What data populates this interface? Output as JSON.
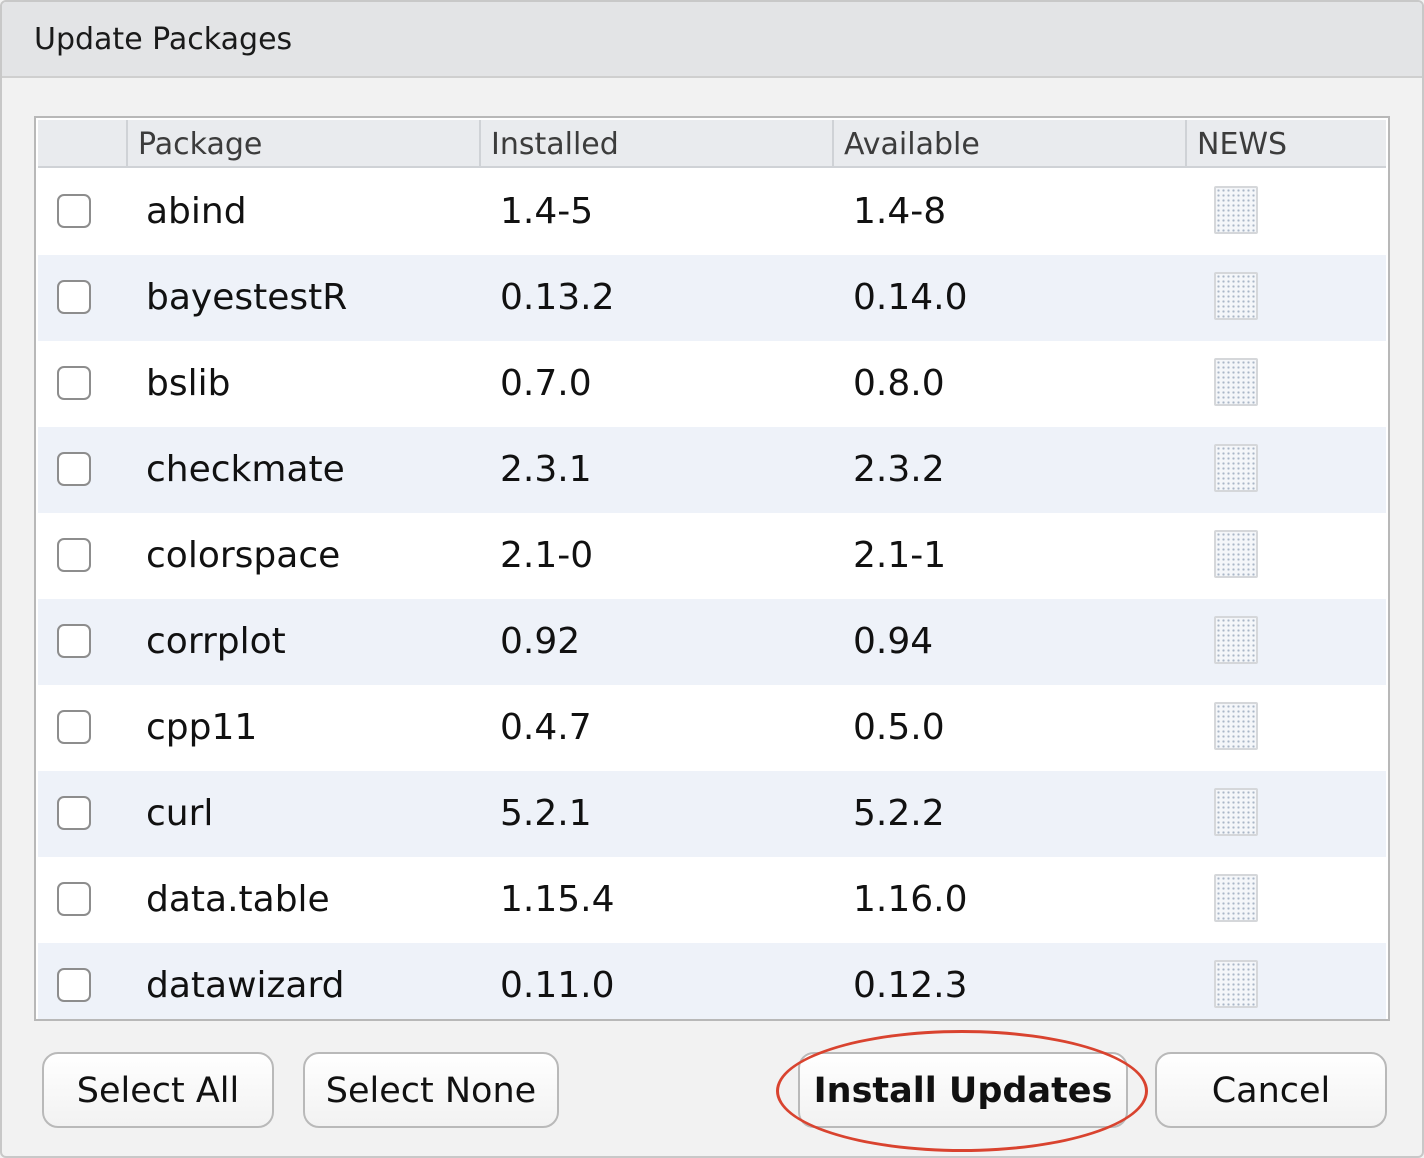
{
  "dialog": {
    "title": "Update Packages"
  },
  "table": {
    "columns": [
      "",
      "Package",
      "Installed",
      "Available",
      "NEWS"
    ],
    "rows": [
      {
        "selected": false,
        "package": "abind",
        "installed": "1.4-5",
        "available": "1.4-8",
        "news_icon": "news-document-icon"
      },
      {
        "selected": false,
        "package": "bayestestR",
        "installed": "0.13.2",
        "available": "0.14.0",
        "news_icon": "news-document-icon"
      },
      {
        "selected": false,
        "package": "bslib",
        "installed": "0.7.0",
        "available": "0.8.0",
        "news_icon": "news-document-icon"
      },
      {
        "selected": false,
        "package": "checkmate",
        "installed": "2.3.1",
        "available": "2.3.2",
        "news_icon": "news-document-icon"
      },
      {
        "selected": false,
        "package": "colorspace",
        "installed": "2.1-0",
        "available": "2.1-1",
        "news_icon": "news-document-icon"
      },
      {
        "selected": false,
        "package": "corrplot",
        "installed": "0.92",
        "available": "0.94",
        "news_icon": "news-document-icon"
      },
      {
        "selected": false,
        "package": "cpp11",
        "installed": "0.4.7",
        "available": "0.5.0",
        "news_icon": "news-document-icon"
      },
      {
        "selected": false,
        "package": "curl",
        "installed": "5.2.1",
        "available": "5.2.2",
        "news_icon": "news-document-icon"
      },
      {
        "selected": false,
        "package": "data.table",
        "installed": "1.15.4",
        "available": "1.16.0",
        "news_icon": "news-document-icon"
      },
      {
        "selected": false,
        "package": "datawizard",
        "installed": "0.11.0",
        "available": "0.12.3",
        "news_icon": "news-document-icon"
      }
    ]
  },
  "buttons": {
    "select_all": "Select All",
    "select_none": "Select None",
    "install_updates": "Install Updates",
    "cancel": "Cancel"
  },
  "colors": {
    "row_alt": "#eef2f9",
    "header_bg": "#e9ebee",
    "highlight_ring": "#d9432f"
  }
}
